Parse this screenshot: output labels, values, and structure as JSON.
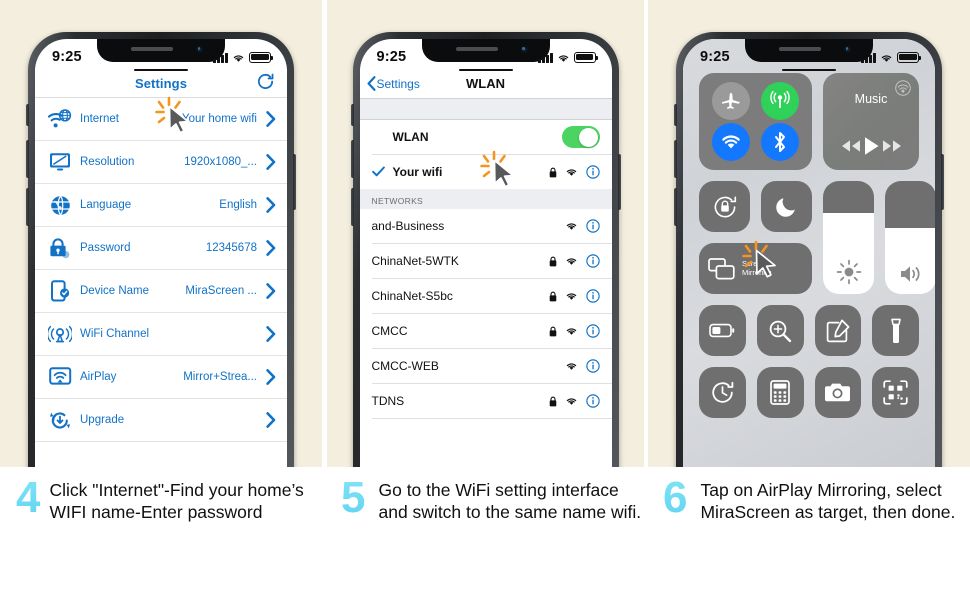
{
  "theme": {
    "panel_bg": "#f4eede",
    "accent_blue": "#1272c6",
    "ios_blue": "#007aff",
    "toggle_green": "#4cd463",
    "number_cyan": "#3ecbf0",
    "cursor_orange": "#f58220"
  },
  "panel1": {
    "status": {
      "time": "9:25",
      "signal": "signal-bars",
      "wifi": "wifi-icon",
      "battery": "battery-full"
    },
    "nav": {
      "title": "Settings",
      "refresh": "refresh-icon"
    },
    "rows": [
      {
        "icon": "internet-globe-wifi-icon",
        "label": "Internet",
        "value": "Your home wifi"
      },
      {
        "icon": "monitor-icon",
        "label": "Resolution",
        "value": "1920x1080_..."
      },
      {
        "icon": "globe-icon",
        "label": "Language",
        "value": "English"
      },
      {
        "icon": "lock-icon",
        "label": "Password",
        "value": "12345678"
      },
      {
        "icon": "device-phone-icon",
        "label": "Device Name",
        "value": "MiraScreen ..."
      },
      {
        "icon": "antenna-icon",
        "label": "WiFi Channel",
        "value": ""
      },
      {
        "icon": "airplay-icon",
        "label": "AirPlay",
        "value": "Mirror+Strea..."
      },
      {
        "icon": "upgrade-icon",
        "label": "Upgrade",
        "value": ""
      }
    ]
  },
  "panel2": {
    "status": {
      "time": "9:25"
    },
    "nav": {
      "back_label": "Settings",
      "title": "WLAN"
    },
    "wlan_toggle": {
      "label": "WLAN",
      "state": "on"
    },
    "connected": {
      "name": "Your wifi",
      "checked": true,
      "locked": true,
      "signal": "wifi-icon",
      "info": "info-icon"
    },
    "section_header": "NETWORKS",
    "networks": [
      {
        "name": "and-Business",
        "locked": false
      },
      {
        "name": "ChinaNet-5WTK",
        "locked": true
      },
      {
        "name": "ChinaNet-S5bc",
        "locked": true
      },
      {
        "name": "CMCC",
        "locked": true
      },
      {
        "name": "CMCC-WEB",
        "locked": false
      },
      {
        "name": "TDNS",
        "locked": true
      }
    ]
  },
  "panel3": {
    "status": {
      "time": "9:25"
    },
    "toggles": [
      {
        "name": "airplane-mode-icon",
        "state": "off",
        "color": "#9a9a9a"
      },
      {
        "name": "cellular-data-icon",
        "state": "on",
        "color": "#30d158"
      },
      {
        "name": "wifi-icon",
        "state": "on",
        "color": "#1478ff"
      },
      {
        "name": "bluetooth-icon",
        "state": "on",
        "color": "#1478ff"
      }
    ],
    "music": {
      "title": "Music",
      "airplay": "airplay-audio-icon",
      "prev": "rewind-icon",
      "play": "play-icon",
      "next": "fast-forward-icon"
    },
    "row2": [
      {
        "name": "rotation-lock-icon"
      },
      {
        "name": "do-not-disturb-moon-icon"
      }
    ],
    "sliders": [
      {
        "name": "brightness-slider",
        "icon": "brightness-sun-icon",
        "level": 72
      },
      {
        "name": "volume-slider",
        "icon": "volume-speaker-icon",
        "level": 58
      }
    ],
    "screen_mirroring": {
      "icon": "screen-mirroring-icon",
      "label_line1": "Screen",
      "label_line2": "Mirroring"
    },
    "row3": [
      {
        "name": "low-power-battery-icon"
      },
      {
        "name": "magnifier-icon"
      },
      {
        "name": "notes-icon"
      },
      {
        "name": "flashlight-icon"
      }
    ],
    "row4": [
      {
        "name": "timer-icon"
      },
      {
        "name": "calculator-icon"
      },
      {
        "name": "camera-icon"
      },
      {
        "name": "qr-code-scanner-icon"
      }
    ]
  },
  "captions": [
    {
      "number": "4",
      "text": "Click \"Internet\"-Find your home’s WIFI name-Enter password"
    },
    {
      "number": "5",
      "text": "Go to the WiFi setting interface and switch to the same name wifi."
    },
    {
      "number": "6",
      "text": "Tap on AirPlay Mirroring, select MiraScreen as target, then done."
    }
  ]
}
